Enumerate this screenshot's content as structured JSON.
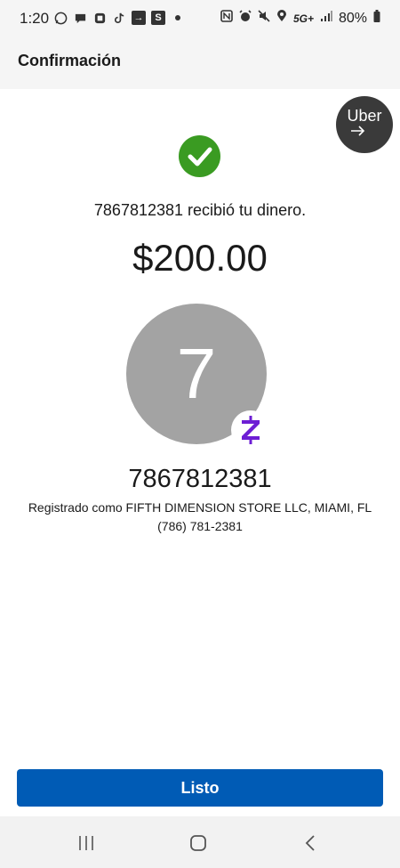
{
  "status_bar": {
    "time": "1:20",
    "battery": "80%",
    "network": "5G+"
  },
  "header": {
    "title": "Confirmación"
  },
  "uber": {
    "label": "Uber"
  },
  "confirmation": {
    "message": "7867812381 recibió tu dinero.",
    "amount": "$200.00"
  },
  "recipient": {
    "avatar_initial": "7",
    "name": "7867812381",
    "registered": "Registrado como FIFTH DIMENSION STORE LLC, MIAMI, FL",
    "phone": "(786) 781-2381"
  },
  "actions": {
    "done_label": "Listo"
  },
  "colors": {
    "check_green": "#3a9b22",
    "primary_blue": "#005bb5",
    "zelle_purple": "#6d1ed4",
    "avatar_gray": "#a3a3a3"
  }
}
